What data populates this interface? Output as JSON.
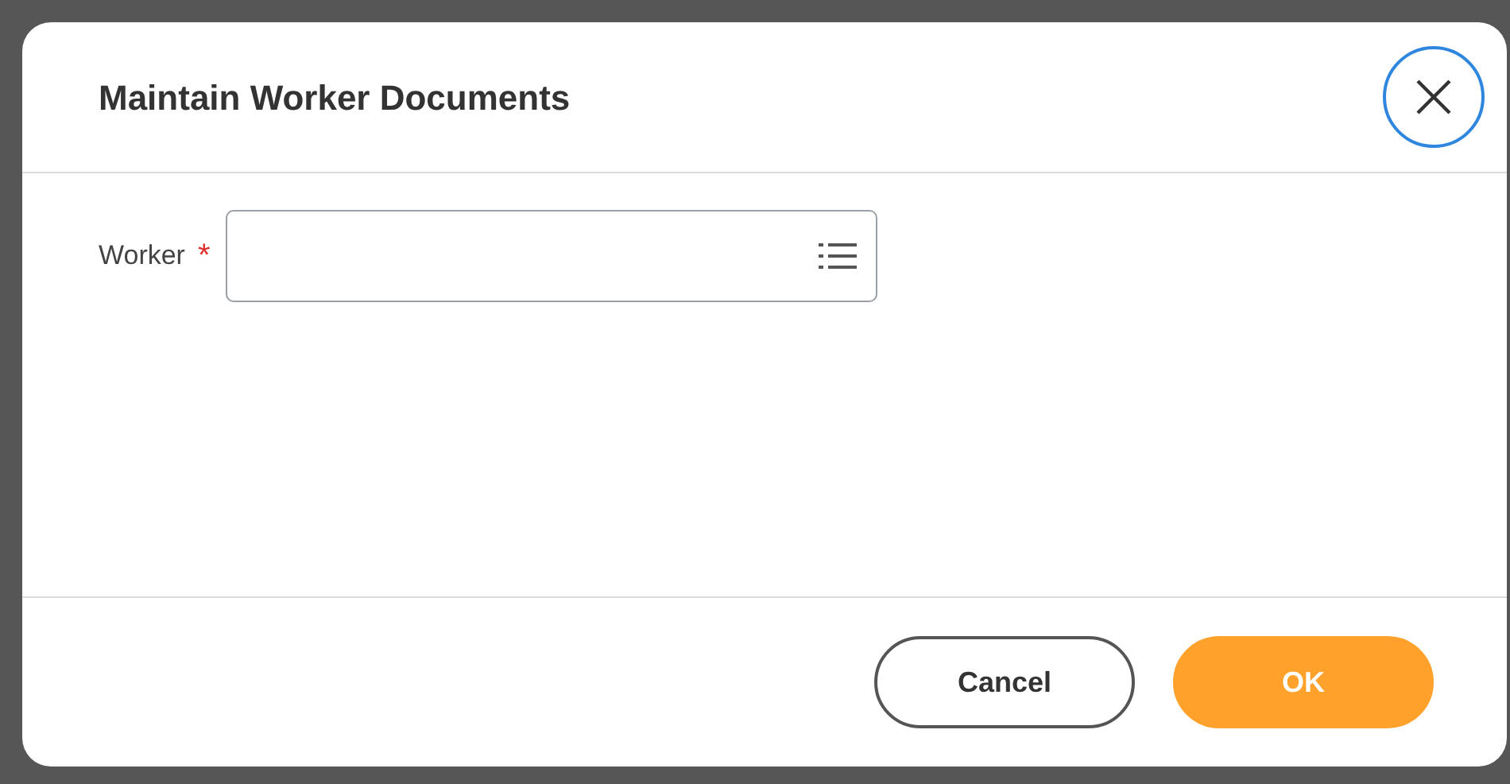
{
  "dialog": {
    "title": "Maintain Worker Documents"
  },
  "fields": [
    {
      "label": "Worker",
      "required": true,
      "required_mark": "*"
    }
  ],
  "buttons": [
    {
      "label": "Cancel",
      "kind": "secondary"
    },
    {
      "label": "OK",
      "kind": "primary"
    }
  ]
}
